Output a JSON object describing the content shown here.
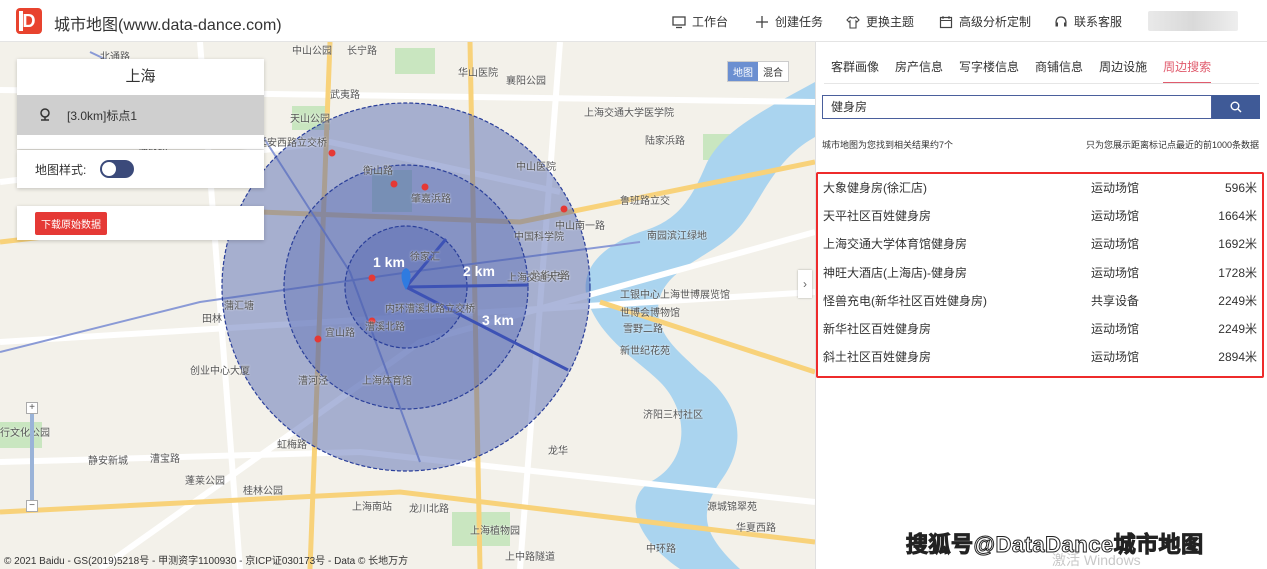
{
  "header": {
    "logo": "D",
    "title": "城市地图(www.data-dance.com)",
    "nav": [
      {
        "label": "工作台",
        "icon": "monitor-icon"
      },
      {
        "label": "创建任务",
        "icon": "plus-icon"
      },
      {
        "label": "更换主题",
        "icon": "shirt-icon"
      },
      {
        "label": "高级分析定制",
        "icon": "calendar-icon"
      },
      {
        "label": "联系客服",
        "icon": "headset-icon"
      }
    ]
  },
  "map": {
    "city": "上海",
    "marker_label": "[3.0km]标点1",
    "style_label": "地图样式:",
    "download_label": "下载原始数据",
    "maptype": {
      "map": "地图",
      "hybrid": "混合"
    },
    "radius_labels": [
      "1 km",
      "2 km",
      "3 km"
    ],
    "copyright": "© 2021 Baidu - GS(2019)5218号 - 甲测资字1100930 - 京ICP证030173号 - Data © 长地万方",
    "place_labels": [
      {
        "t": "中山公园"
      },
      {
        "t": "长宁路"
      },
      {
        "t": "华山医院"
      },
      {
        "t": "襄阳公园"
      },
      {
        "t": "天山公园"
      },
      {
        "t": "武夷路"
      },
      {
        "t": "延安西路立交桥"
      },
      {
        "t": "仙霞路"
      },
      {
        "t": "上海交通大学医学院"
      },
      {
        "t": "中山医院"
      },
      {
        "t": "肇嘉浜路"
      },
      {
        "t": "衡山路"
      },
      {
        "t": "中国科学院"
      },
      {
        "t": "鲁班路立交"
      },
      {
        "t": "南园滨江绿地"
      },
      {
        "t": "中山南一路"
      },
      {
        "t": "徐家汇"
      },
      {
        "t": "漕溪北路"
      },
      {
        "t": "内环漕溪北路立交桥"
      },
      {
        "t": "龙华中路"
      },
      {
        "t": "上海体育馆"
      },
      {
        "t": "宜山路"
      },
      {
        "t": "虹梅路"
      },
      {
        "t": "田林"
      },
      {
        "t": "漕河泾"
      },
      {
        "t": "蒲汇塘"
      },
      {
        "t": "世博会博物馆"
      },
      {
        "t": "工银中心上海世博展览馆"
      },
      {
        "t": "雪野二路"
      },
      {
        "t": "新世纪花苑"
      },
      {
        "t": "龙华"
      },
      {
        "t": "济阳三村社区"
      },
      {
        "t": "上海南站"
      },
      {
        "t": "龙川北路"
      },
      {
        "t": "上海植物园"
      },
      {
        "t": "漕宝路"
      },
      {
        "t": "桂林公园"
      },
      {
        "t": "静安新城"
      },
      {
        "t": "创业中心大厦"
      },
      {
        "t": "上中路隧道"
      },
      {
        "t": "中环路"
      },
      {
        "t": "华夏西路"
      },
      {
        "t": "源城锦翠苑"
      },
      {
        "t": "行文化公园"
      },
      {
        "t": "北通路"
      },
      {
        "t": "上海交通大学"
      },
      {
        "t": "蓬莱公园"
      },
      {
        "t": "陆家浜路"
      }
    ]
  },
  "side": {
    "tabs": [
      "客群画像",
      "房产信息",
      "写字楼信息",
      "商铺信息",
      "周边设施",
      "周边搜索"
    ],
    "active_tab": 5,
    "search_value": "健身房",
    "info_left": "城市地图为您找到相关结果约7个",
    "info_right": "只为您展示距离标记点最近的前1000条数据",
    "results": [
      {
        "name": "大象健身房(徐汇店)",
        "category": "运动场馆",
        "distance": "596米"
      },
      {
        "name": "天平社区百姓健身房",
        "category": "运动场馆",
        "distance": "1664米"
      },
      {
        "name": "上海交通大学体育馆健身房",
        "category": "运动场馆",
        "distance": "1692米"
      },
      {
        "name": "神旺大酒店(上海店)-健身房",
        "category": "运动场馆",
        "distance": "1728米"
      },
      {
        "name": "怪兽充电(新华社区百姓健身房)",
        "category": "共享设备",
        "distance": "2249米"
      },
      {
        "name": "新华社区百姓健身房",
        "category": "运动场馆",
        "distance": "2249米"
      },
      {
        "name": "斜土社区百姓健身房",
        "category": "运动场馆",
        "distance": "2894米"
      }
    ]
  },
  "overlay": {
    "watermark": "搜狐号@DataDance城市地图",
    "activate": "激活 Windows"
  },
  "colors": {
    "accent_red": "#e05b6d",
    "search_blue": "#3f5a97",
    "circle_fill": "#4a5fb0",
    "result_border": "#ee2b2b"
  }
}
